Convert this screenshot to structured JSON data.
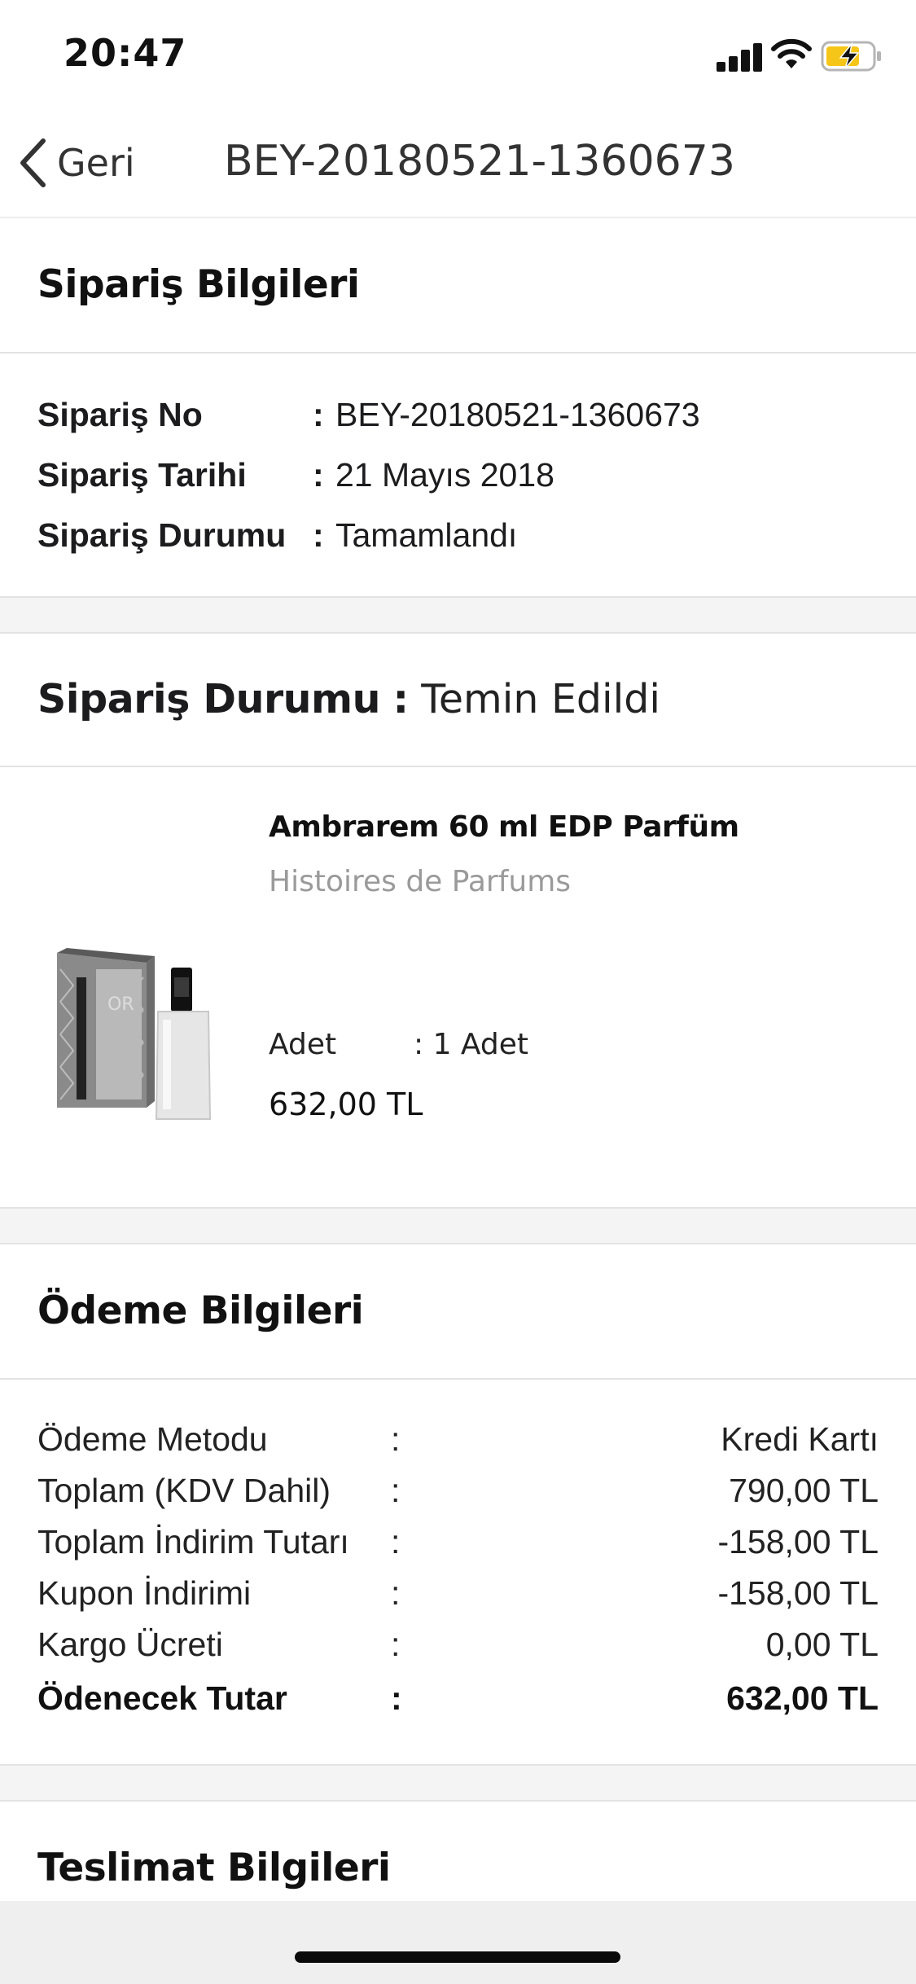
{
  "status_bar": {
    "time": "20:47",
    "icons": [
      "signal-icon",
      "wifi-icon",
      "battery-charging-icon"
    ]
  },
  "nav": {
    "back_label": "Geri",
    "title": "BEY-20180521-1360673"
  },
  "order_info": {
    "heading": "Sipariş Bilgileri",
    "rows": [
      {
        "label": "Sipariş No",
        "colon": ":",
        "value": "BEY-20180521-1360673"
      },
      {
        "label": "Sipariş Tarihi",
        "colon": ":",
        "value": "21 Mayıs 2018"
      },
      {
        "label": "Sipariş Durumu",
        "colon": ":",
        "value": "Tamamlandı"
      }
    ]
  },
  "shipment_status": {
    "label": "Sipariş Durumu",
    "colon": ":",
    "value": "Temin Edildi"
  },
  "product": {
    "name": "Ambrarem 60 ml EDP Parfüm",
    "brand": "Histoires de Parfums",
    "qty_label": "Adet",
    "qty_value": ": 1 Adet",
    "price": "632,00 TL"
  },
  "payment": {
    "heading": "Ödeme Bilgileri",
    "rows": [
      {
        "label": "Ödeme Metodu",
        "colon": ":",
        "value": "Kredi Kartı"
      },
      {
        "label": "Toplam (KDV Dahil)",
        "colon": ":",
        "value": "790,00 TL"
      },
      {
        "label": "Toplam İndirim Tutarı",
        "colon": ":",
        "value": "-158,00 TL"
      },
      {
        "label": "Kupon İndirimi",
        "colon": ":",
        "value": "-158,00 TL"
      },
      {
        "label": "Kargo Ücreti",
        "colon": ":",
        "value": "0,00 TL"
      },
      {
        "label": "Ödenecek Tutar",
        "colon": ":",
        "value": "632,00 TL"
      }
    ]
  },
  "delivery": {
    "heading": "Teslimat Bilgileri"
  },
  "colors": {
    "divider": "#e3e3e3",
    "gap_bg": "#f4f4f4",
    "muted_text": "#9a9a9a",
    "battery_fill": "#f5c518"
  }
}
